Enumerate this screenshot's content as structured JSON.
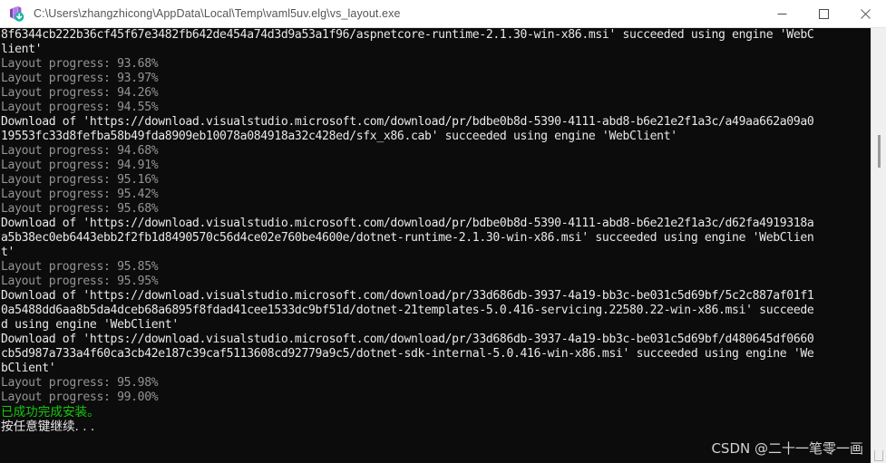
{
  "window": {
    "title": "C:\\Users\\zhangzhicong\\AppData\\Local\\Temp\\vaml5uv.elg\\vs_layout.exe",
    "icon": "visual-studio-installer-icon",
    "controls": {
      "minimize": "minimize-icon",
      "maximize": "maximize-icon",
      "close": "close-icon"
    },
    "background_color": "#0c0c0c",
    "titlebar_color": "#ffffff"
  },
  "colors": {
    "console_background": "#0c0c0c",
    "normal_text": "#cccccc",
    "dim_text": "#949494",
    "bright_text": "#e8e8e8",
    "success_green": "#16c60c",
    "scrollbar_track": "#f0f0f0",
    "scrollbar_thumb": "#9a9a9a"
  },
  "console": {
    "lines": [
      {
        "style": "bright",
        "text": "8f6344cb222b36cf45f67e3482fb642de454a74d3d9a53a1f96/aspnetcore-runtime-2.1.30-win-x86.msi' succeeded using engine 'WebC"
      },
      {
        "style": "bright",
        "text": "lient'"
      },
      {
        "style": "dim",
        "text": "Layout progress: 93.68%"
      },
      {
        "style": "dim",
        "text": "Layout progress: 93.97%"
      },
      {
        "style": "dim",
        "text": "Layout progress: 94.26%"
      },
      {
        "style": "dim",
        "text": "Layout progress: 94.55%"
      },
      {
        "style": "bright",
        "text": "Download of 'https://download.visualstudio.microsoft.com/download/pr/bdbe0b8d-5390-4111-abd8-b6e21e2f1a3c/a49aa662a09a0"
      },
      {
        "style": "bright",
        "text": "19553fc33d8fefba58b49fda8909eb10078a084918a32c428ed/sfx_x86.cab' succeeded using engine 'WebClient'"
      },
      {
        "style": "dim",
        "text": "Layout progress: 94.68%"
      },
      {
        "style": "dim",
        "text": "Layout progress: 94.91%"
      },
      {
        "style": "dim",
        "text": "Layout progress: 95.16%"
      },
      {
        "style": "dim",
        "text": "Layout progress: 95.42%"
      },
      {
        "style": "dim",
        "text": "Layout progress: 95.68%"
      },
      {
        "style": "bright",
        "text": "Download of 'https://download.visualstudio.microsoft.com/download/pr/bdbe0b8d-5390-4111-abd8-b6e21e2f1a3c/d62fa4919318a"
      },
      {
        "style": "bright",
        "text": "a5b38ec0eb6443ebb2f2fb1d8490570c56d4ce02e760be4600e/dotnet-runtime-2.1.30-win-x86.msi' succeeded using engine 'WebClien"
      },
      {
        "style": "bright",
        "text": "t'"
      },
      {
        "style": "dim",
        "text": "Layout progress: 95.85%"
      },
      {
        "style": "dim",
        "text": "Layout progress: 95.95%"
      },
      {
        "style": "bright",
        "text": "Download of 'https://download.visualstudio.microsoft.com/download/pr/33d686db-3937-4a19-bb3c-be031c5d69bf/5c2c887af01f1"
      },
      {
        "style": "bright",
        "text": "0a5488dd6aa8b5da4dceb68a6895f8fdad41cee1533dc9bf51d/dotnet-21templates-5.0.416-servicing.22580.22-win-x86.msi' succeede"
      },
      {
        "style": "bright",
        "text": "d using engine 'WebClient'"
      },
      {
        "style": "bright",
        "text": "Download of 'https://download.visualstudio.microsoft.com/download/pr/33d686db-3937-4a19-bb3c-be031c5d69bf/d480645df0660"
      },
      {
        "style": "bright",
        "text": "cb5d987a733a4f60ca3cb42e187c39caf5113608cd92779a9c5/dotnet-sdk-internal-5.0.416-win-x86.msi' succeeded using engine 'We"
      },
      {
        "style": "bright",
        "text": "bClient'"
      },
      {
        "style": "dim",
        "text": "Layout progress: 95.98%"
      },
      {
        "style": "dim",
        "text": "Layout progress: 99.00%"
      },
      {
        "style": "green cjk",
        "text": "已成功完成安装。"
      },
      {
        "style": "bright cjk",
        "text": "按任意键继续. . ."
      }
    ]
  },
  "scrollbar": {
    "name": "vertical-scrollbar"
  },
  "watermark": {
    "text": "CSDN @二十一笔零一画"
  }
}
